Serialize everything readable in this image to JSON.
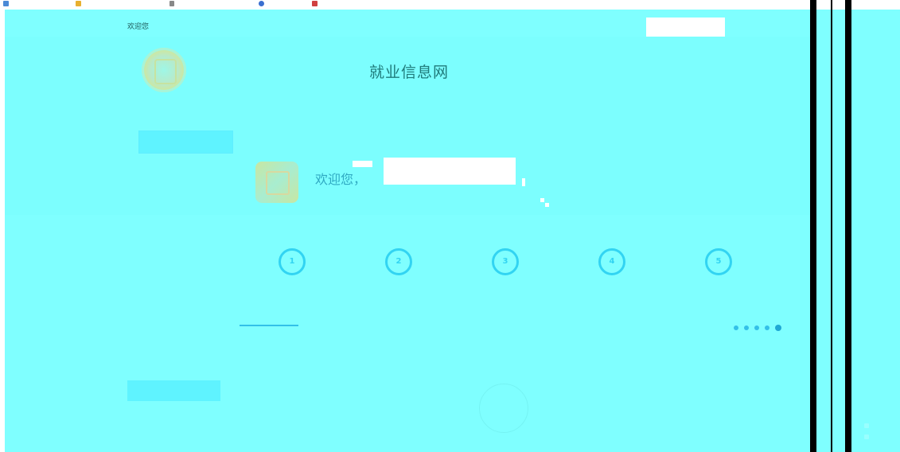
{
  "bookmarks": [
    {
      "label": "",
      "icon": "apps-icon"
    },
    {
      "label": "",
      "icon": "star-icon"
    },
    {
      "label": "",
      "icon": "document-icon"
    },
    {
      "label": "",
      "icon": "globe-icon"
    },
    {
      "label": "",
      "icon": "bookmark-icon"
    }
  ],
  "header": {
    "welcome_top": "欢迎您",
    "top_link": "",
    "site_title": "就业信息网",
    "site_sub": "",
    "nav_label": "",
    "nav_button": ""
  },
  "profile": {
    "welcome": "欢迎您，",
    "company": ""
  },
  "steps": [
    "1",
    "2",
    "3",
    "4",
    "5"
  ],
  "tabs": [
    {
      "label": ""
    }
  ],
  "pager": {
    "count": 5,
    "active": 4
  },
  "bottom": {
    "button": ""
  },
  "colors": {
    "accent": "#33c0e8",
    "background": "#7fffff",
    "title": "#1f7a7a"
  }
}
